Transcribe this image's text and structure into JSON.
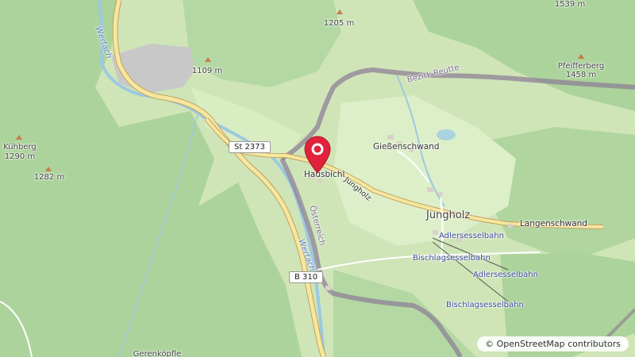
{
  "map": {
    "places": {
      "hausbichl": "Hausbichl",
      "giessenschwand": "Gießenschwand",
      "jungholz": "Jungholz",
      "langenschwand": "Langenschwand",
      "kuhberg": "Kühberg",
      "pfeifferberg": "Pfeifferberg",
      "gerenkoepfle": "Gerenköpfle"
    },
    "elevations": {
      "e1205": "1205 m",
      "e1109": "1109 m",
      "e1290": "1290 m",
      "e1282": "1282 m",
      "e1458": "1458 m",
      "e1539": "1539 m"
    },
    "roads": {
      "st2373": "St 2373",
      "b310": "B 310",
      "jungholz_road": "Jungholz"
    },
    "rivers": {
      "wertach_north": "Wertach",
      "wertach_south": "Wertach",
      "osterreich": "Österreich"
    },
    "admin": {
      "bezirk_reutte": "Bezirk Reutte"
    },
    "lifts": {
      "adlersesselbahn_1": "Adlersesselbahn",
      "bischlagsesselbahn_1": "Bischlagsesselbahn",
      "adlersesselbahn_2": "Adlersesselbahn",
      "bischlagsesselbahn_2": "Bischlagsesselbahn"
    },
    "attribution": "© OpenStreetMap contributors",
    "colors": {
      "forest": "#abd29a",
      "meadow": "#d7ecc0",
      "water": "#aad3df",
      "road_main": "#f6e79e",
      "border": "#8a7a94",
      "marker": "#e0223c"
    },
    "icons": {
      "marker": "location-pin-icon",
      "peak": "peak-triangle-icon",
      "quarry": "quarry-icon"
    }
  }
}
